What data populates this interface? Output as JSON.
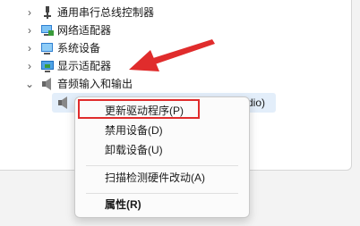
{
  "tree": {
    "items": [
      {
        "label": "通用串行总线控制器",
        "icon": "usb-icon"
      },
      {
        "label": "网络适配器",
        "icon": "network-adapter-icon"
      },
      {
        "label": "系统设备",
        "icon": "system-device-icon"
      },
      {
        "label": "显示适配器",
        "icon": "display-adapter-icon"
      },
      {
        "label": "音频输入和输出",
        "icon": "speaker-icon"
      }
    ],
    "child_label": "(Realtek(R) ... ... ... ...dio)",
    "child_label_tail": "dio)"
  },
  "context_menu": {
    "update_driver": "更新驱动程序(P)",
    "disable_device": "禁用设备(D)",
    "uninstall_device": "卸载设备(U)",
    "scan_hardware": "扫描检测硬件改动(A)",
    "properties": "属性(R)"
  },
  "colors": {
    "arrow": "#e02c2c",
    "highlight_border": "#e02c2c",
    "selection": "#e3eefa"
  }
}
